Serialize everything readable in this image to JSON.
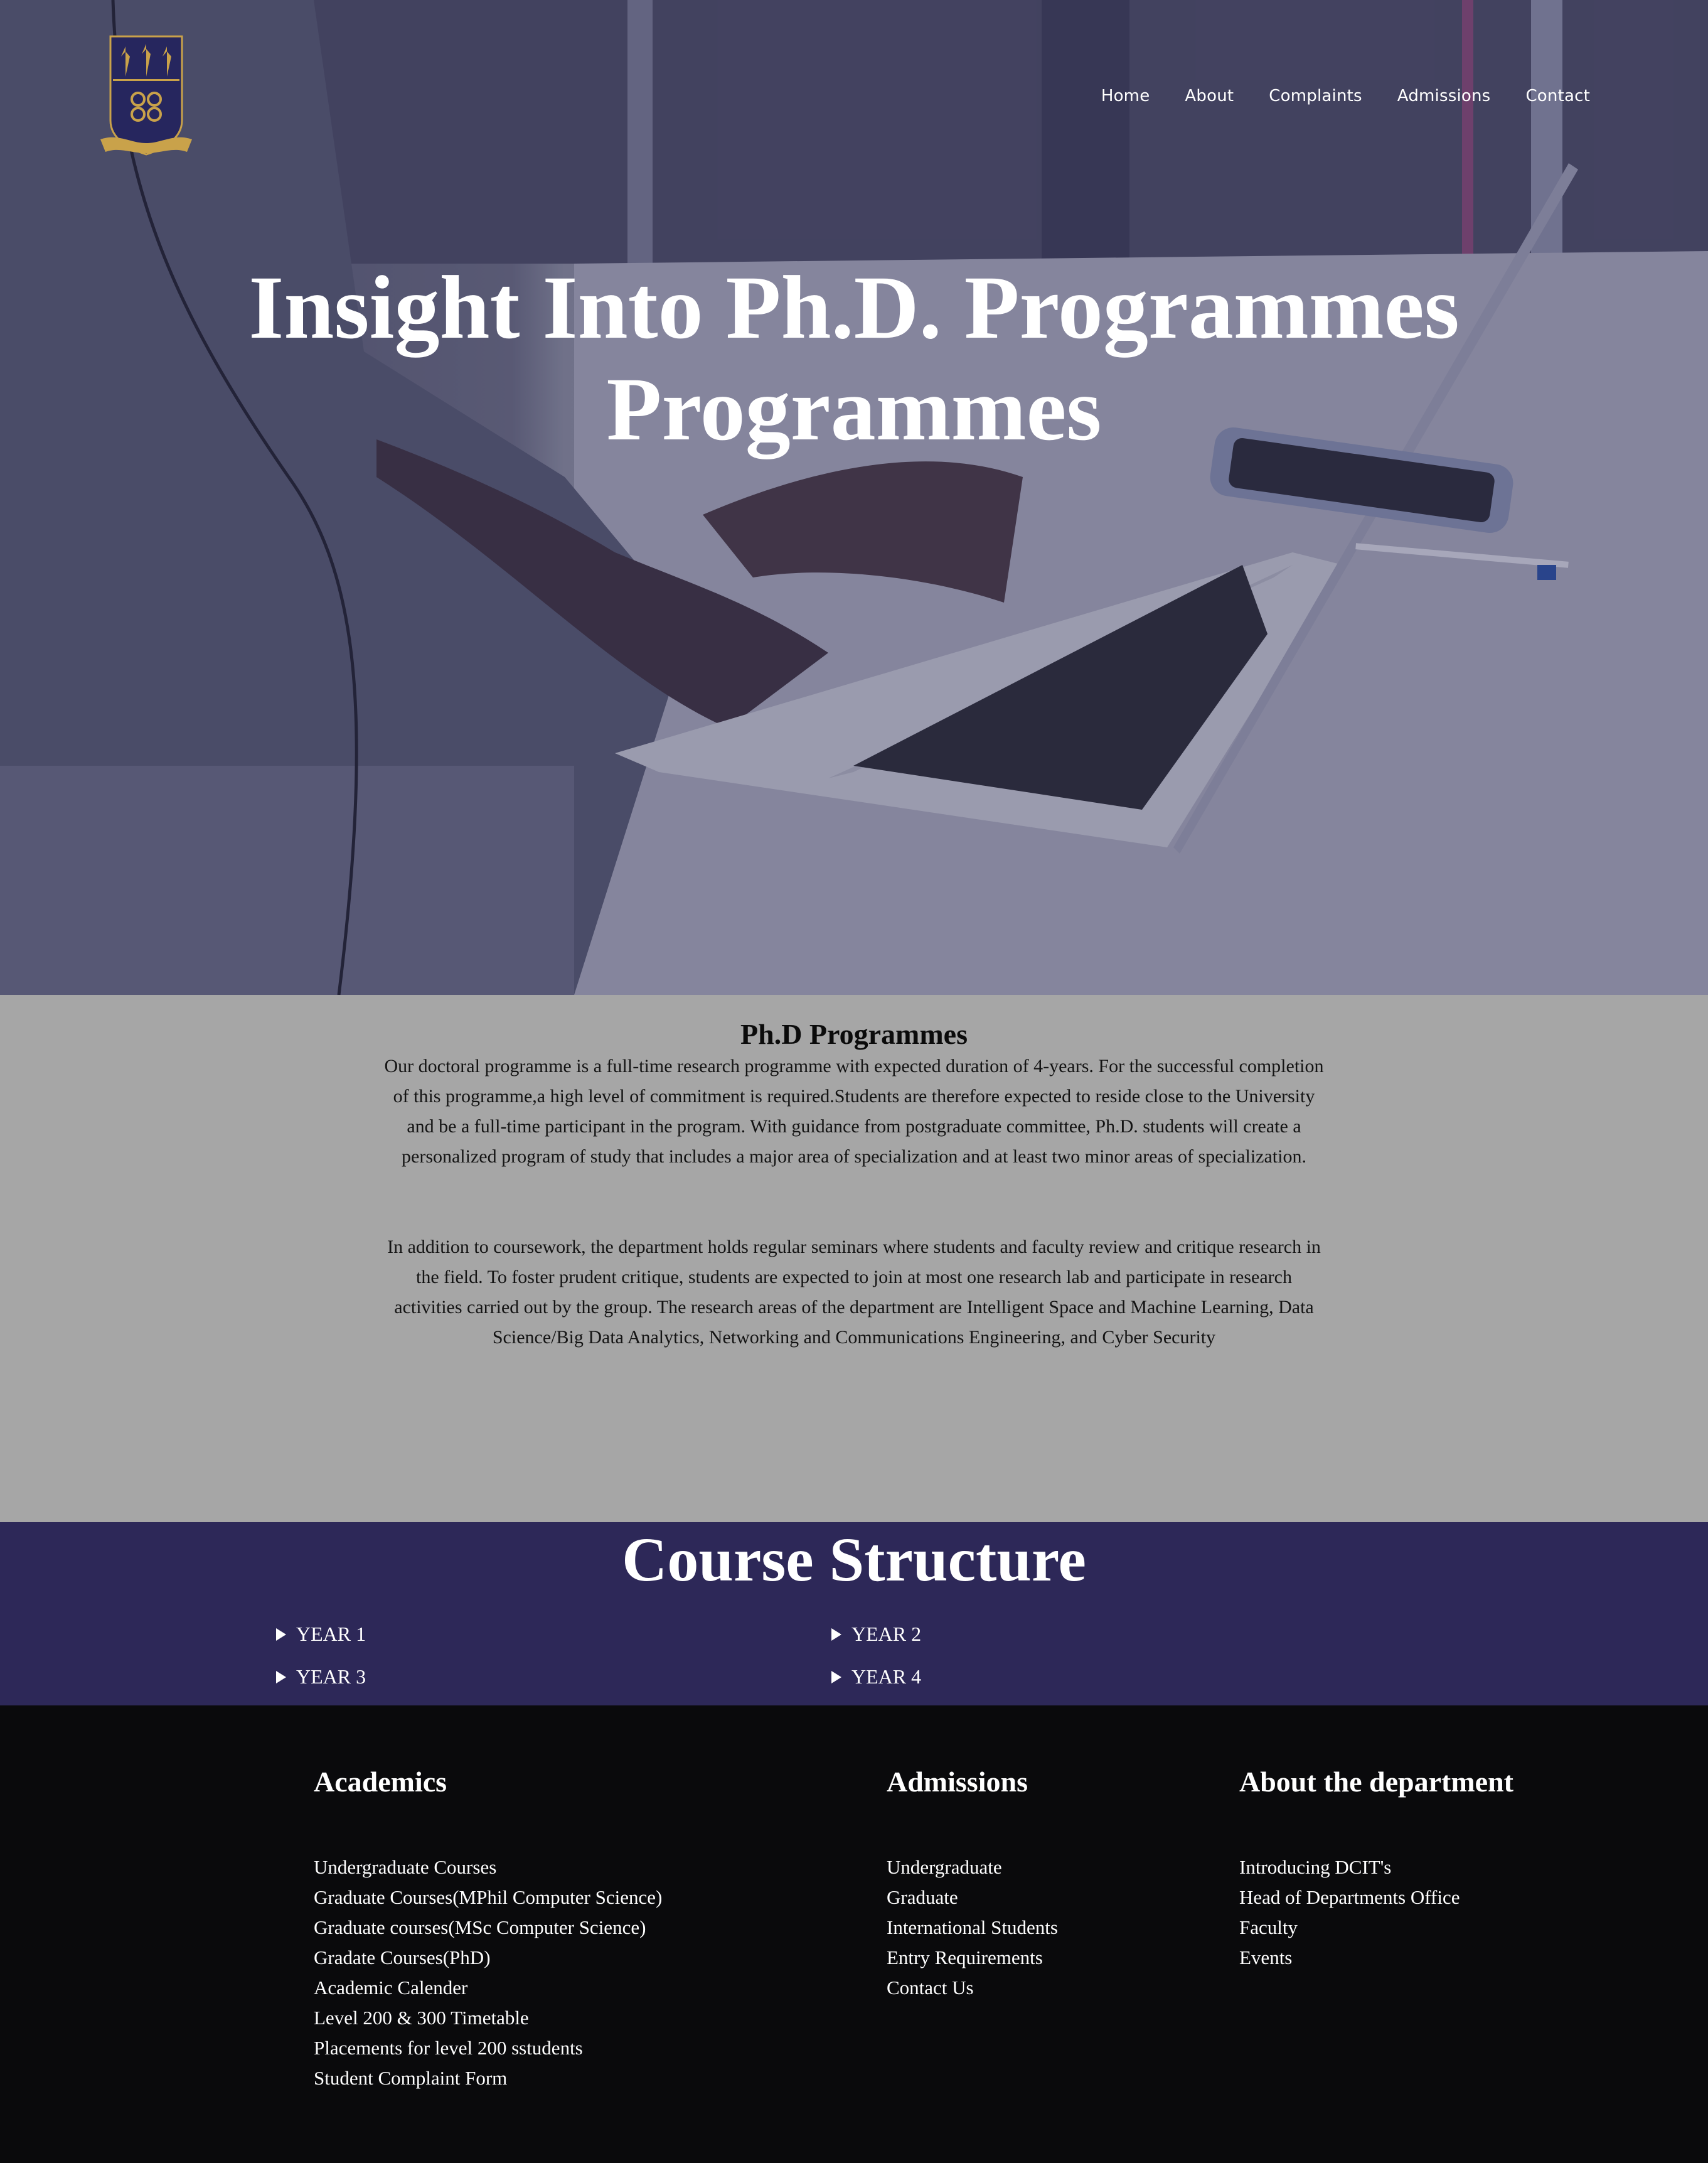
{
  "nav": {
    "items": [
      "Home",
      "About",
      "Complaints",
      "Admissions",
      "Contact"
    ]
  },
  "hero": {
    "title_line1": "Insight Into Ph.D. Programmes",
    "title_line2": "Programmes"
  },
  "intro": {
    "heading": "Ph.D Programmes",
    "paragraph1": "Our doctoral programme is a full-time research programme with expected duration of 4-years. For the successful completion of this programme,a high level of commitment is required.Students are therefore expected to reside close to the University and be a full-time participant in the program. With guidance from postgraduate committee, Ph.D. students will create a personalized program of study that includes a major area of specialization and at least two minor areas of specialization.",
    "paragraph2": "In addition to coursework, the department holds regular seminars where students and faculty review and critique research in the field. To foster prudent critique, students are expected to join at most one research lab and participate in research activities carried out by the group. The research areas of the department are Intelligent Space and Machine Learning, Data Science/Big Data Analytics, Networking and Communications Engineering, and Cyber Security"
  },
  "course": {
    "heading": "Course Structure",
    "years": [
      "YEAR 1",
      "YEAR 2",
      "YEAR 3",
      "YEAR 4"
    ]
  },
  "footer": {
    "academics": {
      "heading": "Academics",
      "links": [
        "Undergraduate Courses",
        "Graduate Courses(MPhil Computer Science)",
        "Graduate courses(MSc Computer Science)",
        "Gradate Courses(PhD)",
        "Academic Calender",
        "Level 200 & 300 Timetable",
        "Placements for level 200 sstudents",
        "Student Complaint Form"
      ]
    },
    "admissions": {
      "heading": "Admissions",
      "links": [
        "Undergraduate",
        "Graduate",
        "International Students",
        "Entry Requirements",
        "Contact Us"
      ]
    },
    "about": {
      "heading": "About the department",
      "links": [
        "Introducing DCIT's",
        "Head of Departments Office",
        "Faculty",
        "Events"
      ]
    }
  },
  "colors": {
    "brand_purple": "#2d2858",
    "intro_bg": "#a6a6a6",
    "footer_bg": "#0a0a0c",
    "logo_gold": "#c9a24a",
    "logo_navy": "#26265e"
  },
  "icons": [
    "university-crest-icon",
    "disclosure-triangle-icon"
  ]
}
